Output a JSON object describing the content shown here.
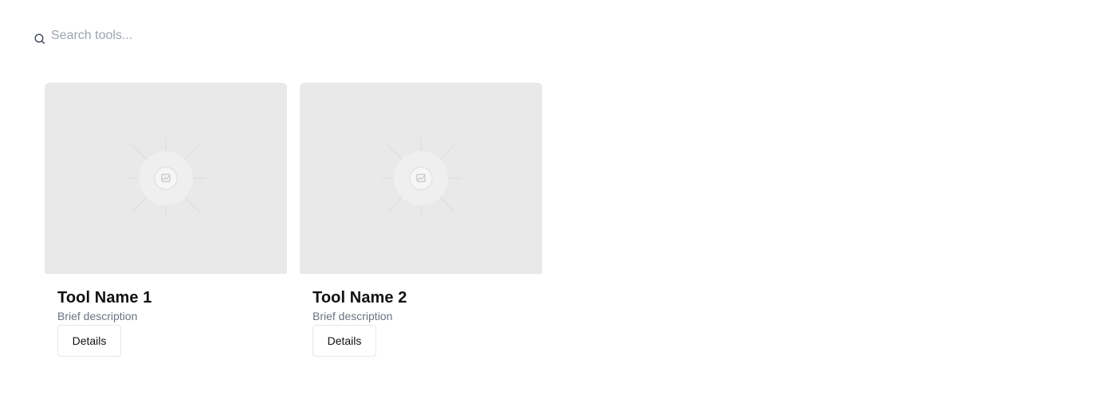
{
  "search": {
    "placeholder": "Search tools...",
    "value": "",
    "icon": "search-icon"
  },
  "tools": [
    {
      "name": "Tool Name 1",
      "description": "Brief description",
      "button_label": "Details",
      "image_icon": "image-placeholder-icon"
    },
    {
      "name": "Tool Name 2",
      "description": "Brief description",
      "button_label": "Details",
      "image_icon": "image-placeholder-icon"
    }
  ],
  "colors": {
    "background": "#ffffff",
    "card_media": "#e9e9e9",
    "title": "#111111",
    "description": "#6b7280",
    "placeholder": "#9ca3af",
    "border": "#e5e7eb"
  }
}
